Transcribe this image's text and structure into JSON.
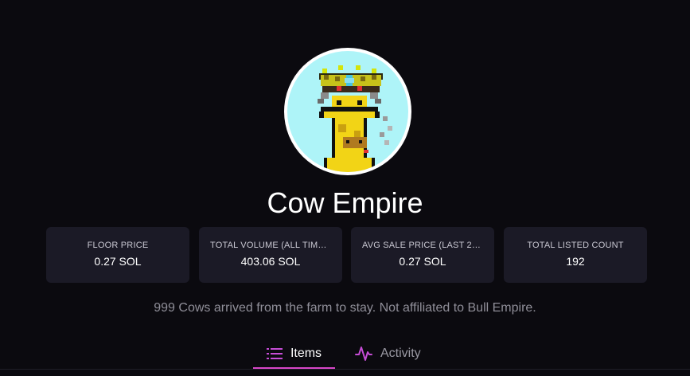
{
  "collection": {
    "name": "Cow Empire",
    "description": "999 Cows arrived from the farm to stay. Not affiliated to Bull Empire.",
    "avatar_icon": "pixel-cow-with-crown"
  },
  "stats": [
    {
      "label": "FLOOR PRICE",
      "value": "0.27 SOL"
    },
    {
      "label": "TOTAL VOLUME (ALL TIME...",
      "value": "403.06 SOL"
    },
    {
      "label": "AVG SALE PRICE (LAST 24...",
      "value": "0.27 SOL"
    },
    {
      "label": "TOTAL LISTED COUNT",
      "value": "192"
    }
  ],
  "tabs": [
    {
      "label": "Items",
      "icon": "list-icon",
      "active": true
    },
    {
      "label": "Activity",
      "icon": "activity-icon",
      "active": false
    }
  ],
  "colors": {
    "background": "#0b0a0f",
    "card": "#1b1a26",
    "accent": "#d846c8",
    "avatar_bg": "#aef4f8"
  }
}
